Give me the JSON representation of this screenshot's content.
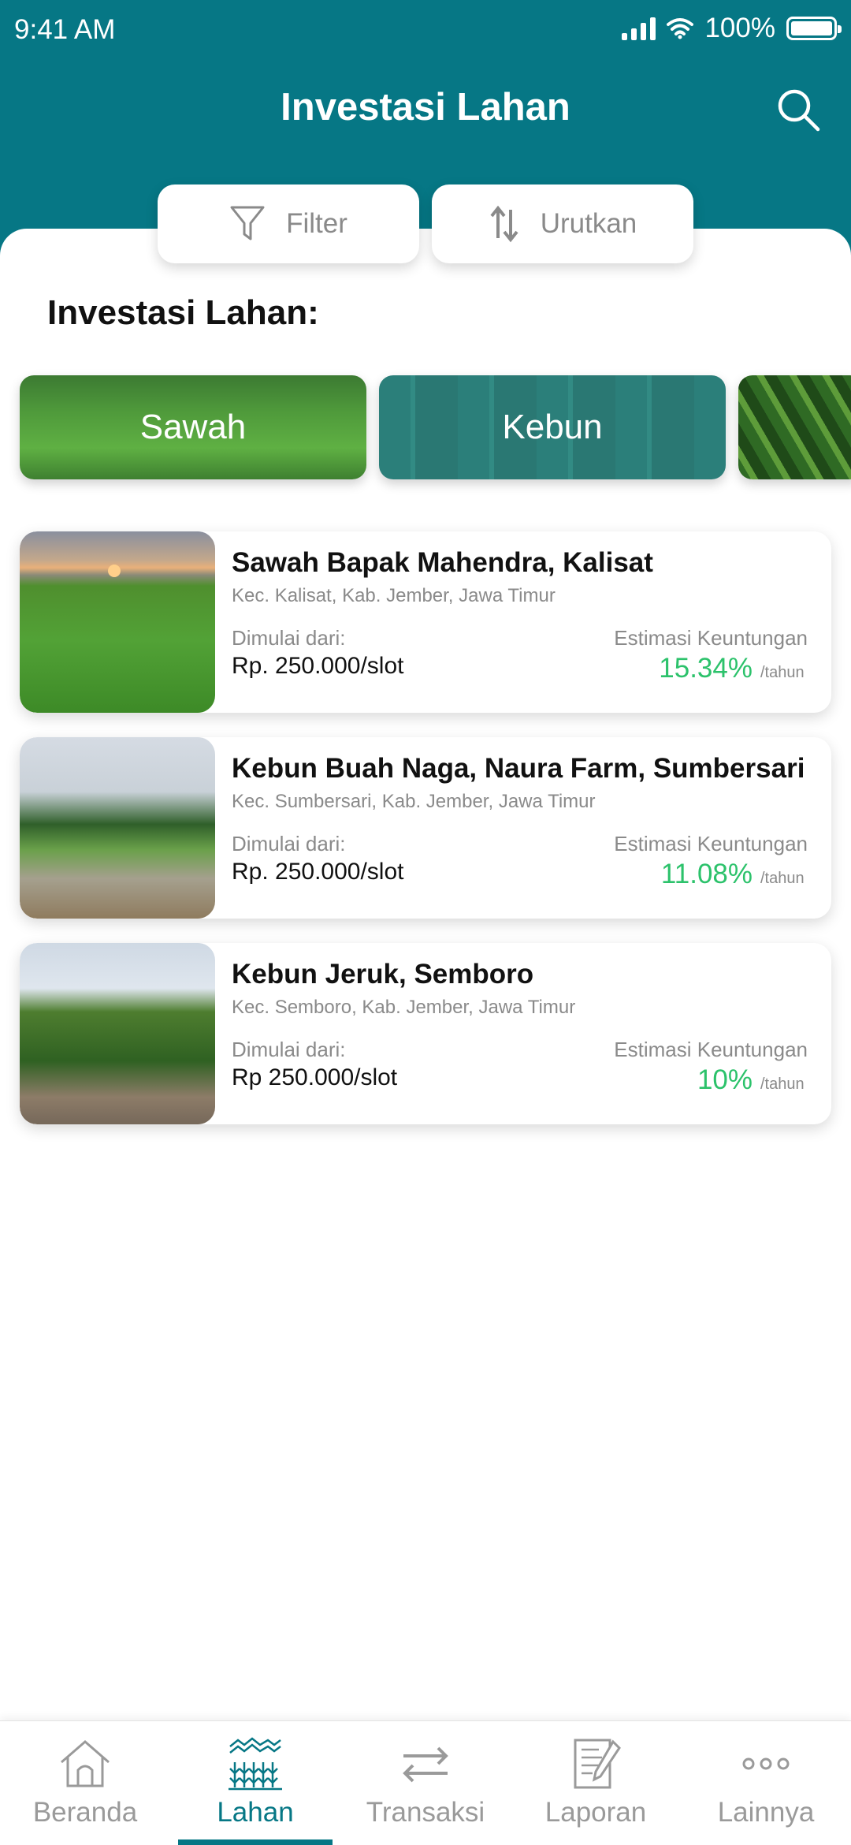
{
  "status_bar": {
    "time": "9:41 AM",
    "battery": "100%"
  },
  "header": {
    "title": "Investasi Lahan"
  },
  "toolbar": {
    "filter_label": "Filter",
    "sort_label": "Urutkan"
  },
  "section": {
    "title": "Investasi Lahan:"
  },
  "categories": [
    {
      "label": "Sawah"
    },
    {
      "label": "Kebun"
    },
    {
      "label": ""
    }
  ],
  "listings": [
    {
      "name": "Sawah Bapak Mahendra, Kalisat",
      "location": "Kec. Kalisat, Kab. Jember, Jawa Timur",
      "start_label": "Dimulai dari:",
      "price": "Rp. 250.000/slot",
      "estimate_label": "Estimasi Keuntungan",
      "profit": "15.34%",
      "profit_unit": "/tahun"
    },
    {
      "name": "Kebun Buah Naga, Naura Farm, Sumbersari",
      "location": "Kec. Sumbersari, Kab. Jember, Jawa Timur",
      "start_label": "Dimulai dari:",
      "price": "Rp. 250.000/slot",
      "estimate_label": "Estimasi Keuntungan",
      "profit": "11.08%",
      "profit_unit": "/tahun"
    },
    {
      "name": "Kebun Jeruk, Semboro",
      "location": "Kec. Semboro, Kab. Jember, Jawa Timur",
      "start_label": "Dimulai dari:",
      "price": "Rp 250.000/slot",
      "estimate_label": "Estimasi Keuntungan",
      "profit": "10%",
      "profit_unit": "/tahun"
    }
  ],
  "bottom_nav": {
    "items": [
      {
        "label": "Beranda",
        "icon": "home-icon"
      },
      {
        "label": "Lahan",
        "icon": "field-icon"
      },
      {
        "label": "Transaksi",
        "icon": "transfer-icon"
      },
      {
        "label": "Laporan",
        "icon": "report-icon"
      },
      {
        "label": "Lainnya",
        "icon": "more-icon"
      }
    ],
    "active": "Lahan"
  },
  "colors": {
    "primary": "#067785",
    "profit": "#2cc26b",
    "muted": "#8a8a8a"
  }
}
